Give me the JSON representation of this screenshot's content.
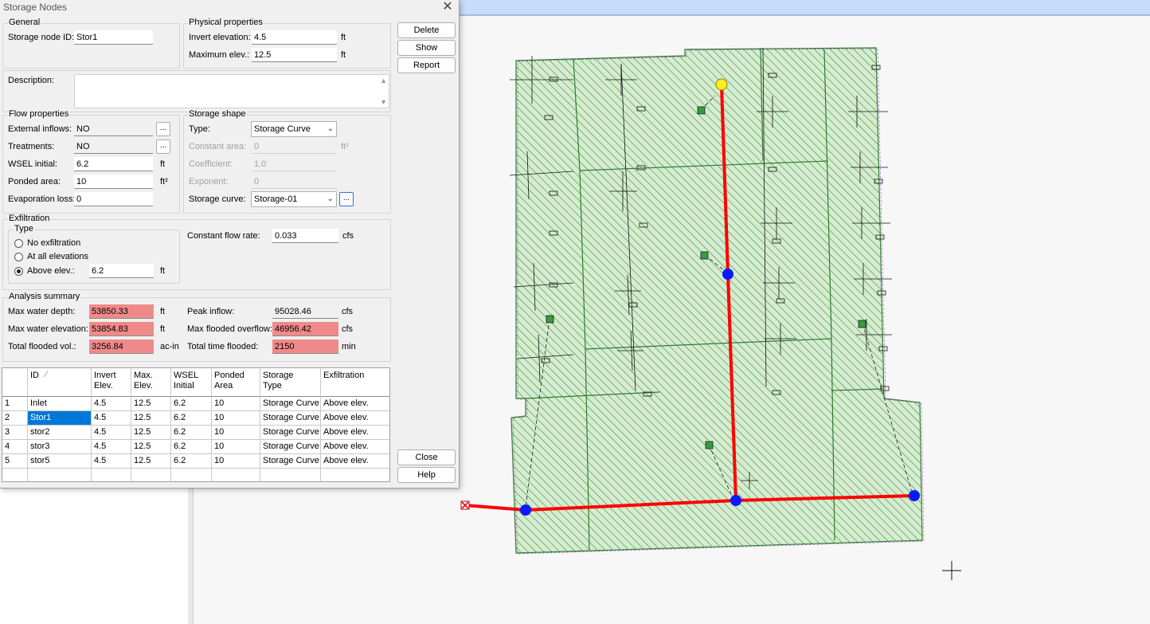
{
  "dialog": {
    "title": "Storage Nodes",
    "close_glyph": "✕",
    "general": {
      "title": "General",
      "id_label": "Storage node ID:",
      "id_value": "Stor1"
    },
    "physical": {
      "title": "Physical properties",
      "invert_label": "Invert elevation:",
      "invert_value": "4.5",
      "invert_unit": "ft",
      "max_label": "Maximum elev.:",
      "max_value": "12.5",
      "max_unit": "ft"
    },
    "buttons": {
      "delete": "Delete",
      "show": "Show",
      "report": "Report",
      "close": "Close",
      "help": "Help"
    },
    "description": {
      "label": "Description:",
      "value": ""
    },
    "flow": {
      "title": "Flow properties",
      "ext_label": "External inflows:",
      "ext_value": "NO",
      "treat_label": "Treatments:",
      "treat_value": "NO",
      "wsel_label": "WSEL initial:",
      "wsel_value": "6.2",
      "wsel_unit": "ft",
      "ponded_label": "Ponded area:",
      "ponded_value": "10",
      "ponded_unit": "ft²",
      "evap_label": "Evaporation loss:",
      "evap_value": "0",
      "dots": "..."
    },
    "shape": {
      "title": "Storage shape",
      "type_label": "Type:",
      "type_value": "Storage Curve",
      "const_label": "Constant area:",
      "const_value": "0",
      "const_unit": "ft²",
      "coef_label": "Coefficient:",
      "coef_value": "1.0",
      "exp_label": "Exponent:",
      "exp_value": "0",
      "curve_label": "Storage curve:",
      "curve_value": "Storage-01"
    },
    "exfil": {
      "title": "Exfiltration",
      "type_title": "Type",
      "opt_none": "No exfiltration",
      "opt_all": "At all elevations",
      "opt_above": "Above elev.:",
      "above_value": "6.2",
      "above_unit": "ft",
      "rate_label": "Constant flow rate:",
      "rate_value": "0.033",
      "rate_unit": "cfs"
    },
    "summary": {
      "title": "Analysis summary",
      "depth_label": "Max water depth:",
      "depth_value": "53850.33",
      "depth_unit": "ft",
      "elev_label": "Max water elevation:",
      "elev_value": "53854.83",
      "elev_unit": "ft",
      "vol_label": "Total flooded vol.:",
      "vol_value": "3256.84",
      "vol_unit": "ac-in",
      "inflow_label": "Peak inflow:",
      "inflow_value": "95028.46",
      "inflow_unit": "cfs",
      "overflow_label": "Max flooded overflow:",
      "overflow_value": "46956.42",
      "overflow_unit": "cfs",
      "time_label": "Total time flooded:",
      "time_value": "2150",
      "time_unit": "min"
    },
    "grid": {
      "headers": [
        {
          "l1": "ID",
          "l2": ""
        },
        {
          "l1": "Invert",
          "l2": "Elev."
        },
        {
          "l1": "Max.",
          "l2": "Elev."
        },
        {
          "l1": "WSEL",
          "l2": "Initial"
        },
        {
          "l1": "Ponded",
          "l2": "Area"
        },
        {
          "l1": "Storage",
          "l2": "Type"
        },
        {
          "l1": "Exfiltration",
          "l2": ""
        }
      ],
      "sort_glyph": "⁄",
      "rows": [
        {
          "n": "1",
          "cells": [
            "Inlet",
            "4.5",
            "12.5",
            "6.2",
            "10",
            "Storage Curve",
            "Above elev."
          ]
        },
        {
          "n": "2",
          "cells": [
            "Stor1",
            "4.5",
            "12.5",
            "6.2",
            "10",
            "Storage Curve",
            "Above elev."
          ]
        },
        {
          "n": "3",
          "cells": [
            "stor2",
            "4.5",
            "12.5",
            "6.2",
            "10",
            "Storage Curve",
            "Above elev."
          ]
        },
        {
          "n": "4",
          "cells": [
            "stor3",
            "4.5",
            "12.5",
            "6.2",
            "10",
            "Storage Curve",
            "Above elev."
          ]
        },
        {
          "n": "5",
          "cells": [
            "stor5",
            "4.5",
            "12.5",
            "6.2",
            "10",
            "Storage Curve",
            "Above elev."
          ]
        }
      ],
      "selected_row": 1
    }
  },
  "map": {
    "colors": {
      "hatch": "#2e7d2e",
      "fill": "#cfe8c8",
      "link": "#ff0000",
      "node": "#0a1aff",
      "outfall": "#ffee22",
      "boundary": "#8a2be2"
    }
  }
}
